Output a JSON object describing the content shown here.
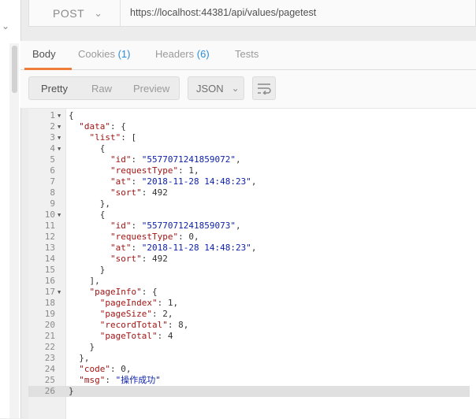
{
  "request": {
    "method": "POST",
    "url": "https://localhost:44381/api/values/pagetest"
  },
  "tabs": [
    {
      "label": "Body",
      "count": ""
    },
    {
      "label": "Cookies",
      "count": "(1)"
    },
    {
      "label": "Headers",
      "count": "(6)"
    },
    {
      "label": "Tests",
      "count": ""
    }
  ],
  "toolbar": {
    "view_modes": [
      "Pretty",
      "Raw",
      "Preview"
    ],
    "format": "JSON",
    "wrap_icon": "wrap-lines-icon"
  },
  "editor": {
    "lines": [
      {
        "n": "1",
        "fold": true,
        "text": "{"
      },
      {
        "n": "2",
        "fold": true,
        "text": "  \"data\": {"
      },
      {
        "n": "3",
        "fold": true,
        "text": "    \"list\": ["
      },
      {
        "n": "4",
        "fold": true,
        "text": "      {"
      },
      {
        "n": "5",
        "fold": false,
        "text": "        \"id\": \"5577071241859072\","
      },
      {
        "n": "6",
        "fold": false,
        "text": "        \"requestType\": 1,"
      },
      {
        "n": "7",
        "fold": false,
        "text": "        \"at\": \"2018-11-28 14:48:23\","
      },
      {
        "n": "8",
        "fold": false,
        "text": "        \"sort\": 492"
      },
      {
        "n": "9",
        "fold": false,
        "text": "      },"
      },
      {
        "n": "10",
        "fold": true,
        "text": "      {"
      },
      {
        "n": "11",
        "fold": false,
        "text": "        \"id\": \"5577071241859073\","
      },
      {
        "n": "12",
        "fold": false,
        "text": "        \"requestType\": 0,"
      },
      {
        "n": "13",
        "fold": false,
        "text": "        \"at\": \"2018-11-28 14:48:23\","
      },
      {
        "n": "14",
        "fold": false,
        "text": "        \"sort\": 492"
      },
      {
        "n": "15",
        "fold": false,
        "text": "      }"
      },
      {
        "n": "16",
        "fold": false,
        "text": "    ],"
      },
      {
        "n": "17",
        "fold": true,
        "text": "    \"pageInfo\": {"
      },
      {
        "n": "18",
        "fold": false,
        "text": "      \"pageIndex\": 1,"
      },
      {
        "n": "19",
        "fold": false,
        "text": "      \"pageSize\": 2,"
      },
      {
        "n": "20",
        "fold": false,
        "text": "      \"recordTotal\": 8,"
      },
      {
        "n": "21",
        "fold": false,
        "text": "      \"pageTotal\": 4"
      },
      {
        "n": "22",
        "fold": false,
        "text": "    }"
      },
      {
        "n": "23",
        "fold": false,
        "text": "  },"
      },
      {
        "n": "24",
        "fold": false,
        "text": "  \"code\": 0,"
      },
      {
        "n": "25",
        "fold": false,
        "text": "  \"msg\": \"操作成功\""
      },
      {
        "n": "26",
        "fold": false,
        "text": "}"
      }
    ],
    "highlighted_line": "26"
  }
}
